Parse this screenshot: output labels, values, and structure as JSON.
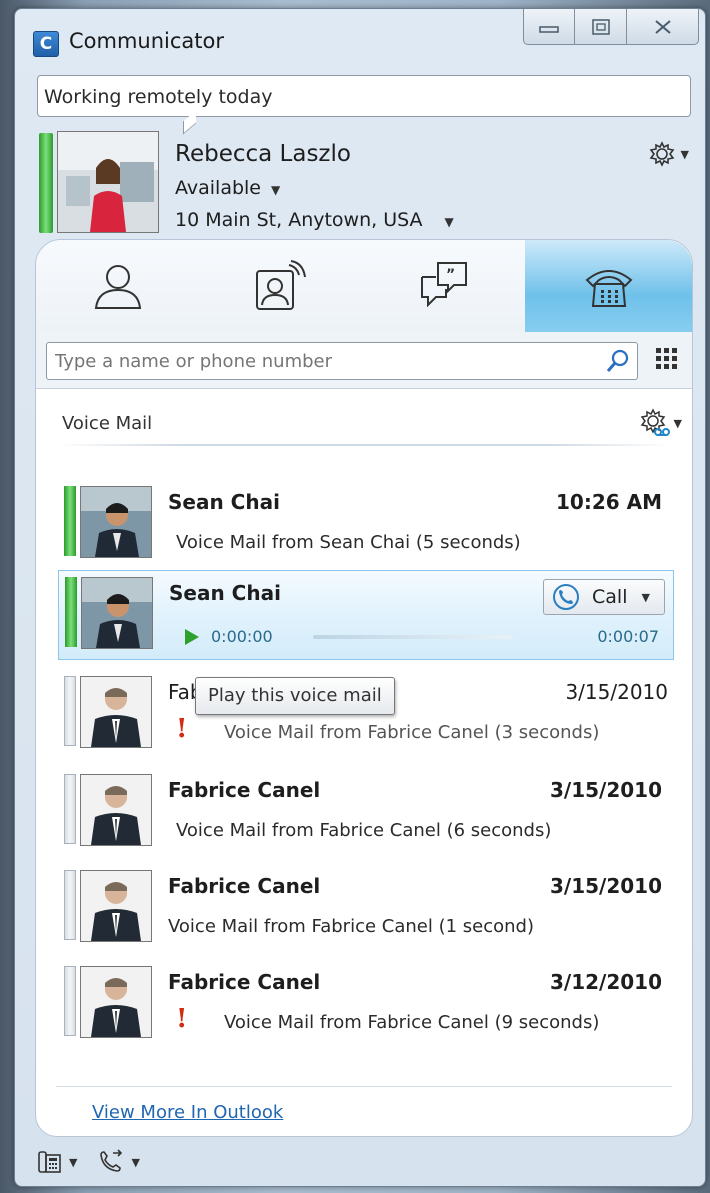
{
  "window": {
    "title": "Communicator",
    "app_icon_letter": "C"
  },
  "personal_note": "Working remotely today",
  "user": {
    "name": "Rebecca Laszlo",
    "status": "Available",
    "location": "10 Main St, Anytown, USA"
  },
  "search": {
    "placeholder": "Type a name or phone number"
  },
  "voicemail": {
    "title": "Voice Mail",
    "items": [
      {
        "name": "Sean Chai",
        "date": "10:26 AM",
        "description": "Voice Mail from Sean Chai (5 seconds)",
        "unread": true,
        "urgent": false
      },
      {
        "name": "Sean Chai",
        "selected": true,
        "call_label": "Call",
        "elapsed": "0:00:00",
        "duration": "0:00:07",
        "progress": 0
      },
      {
        "name": "Fabrice Canel",
        "date": "3/15/2010",
        "description": "Voice Mail from Fabrice Canel (3 seconds)",
        "unread": false,
        "urgent": true
      },
      {
        "name": "Fabrice Canel",
        "date": "3/15/2010",
        "description": "Voice Mail from Fabrice Canel (6 seconds)",
        "unread": true,
        "urgent": false
      },
      {
        "name": "Fabrice Canel",
        "date": "3/15/2010",
        "description": "Voice Mail from Fabrice Canel (1 second)",
        "unread": true,
        "urgent": false
      },
      {
        "name": "Fabrice Canel",
        "date": "3/12/2010",
        "description": "Voice Mail from Fabrice Canel (9 seconds)",
        "unread": true,
        "urgent": true
      }
    ],
    "tooltip": "Play this voice mail",
    "view_more_label": "View More In Outlook",
    "visible_name_fragment": "Fab"
  },
  "colors": {
    "presence_available": "#2c9a2c",
    "active_tab": "#6fc1ea",
    "link": "#1f67b1",
    "urgent": "#d12b10"
  }
}
